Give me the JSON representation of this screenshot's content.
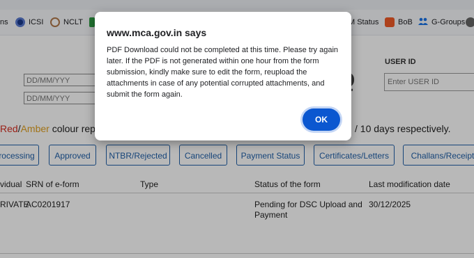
{
  "bookmarks": [
    {
      "label": "ns",
      "icon": "none",
      "color": "#202124"
    },
    {
      "label": "ICSI",
      "icon": "icsi-logo-icon",
      "color": "#1a3a8c"
    },
    {
      "label": "NCLT",
      "icon": "nclt-emblem-icon",
      "color": "#8c5a2a"
    },
    {
      "label": "M Status",
      "icon": "none",
      "color": "#202124"
    },
    {
      "label": "BoB",
      "icon": "bob-logo-icon",
      "color": "#f05a28"
    },
    {
      "label": "G-Groups",
      "icon": "groups-icon",
      "color": "#1a73e8"
    }
  ],
  "form": {
    "from_date_placeholder": "DD/MM/YYY",
    "to_date_placeholder": "DD/MM/YYY",
    "user_id_label": "USER ID",
    "user_id_placeholder": "Enter USER ID"
  },
  "notice": {
    "red": "Red",
    "slash": "/",
    "amber": "Amber",
    "text": " colour repr",
    "tail": "/ 10 days respectively."
  },
  "tabs": [
    {
      "label": "rocessing"
    },
    {
      "label": "Approved"
    },
    {
      "label": "NTBR/Rejected"
    },
    {
      "label": "Cancelled"
    },
    {
      "label": "Payment Status"
    },
    {
      "label": "Certificates/Letters"
    },
    {
      "label": "Challans/Receipts"
    }
  ],
  "table": {
    "headers": [
      "vidual",
      "SRN of e-form",
      "Type",
      "Status of the form",
      "Last modification date"
    ],
    "rows": [
      {
        "col1": "RIVATE",
        "srn": "AC0201917",
        "type": "",
        "status_line1": "Pending for DSC Upload and",
        "status_line2": "Payment",
        "date": "30/12/2025"
      }
    ]
  },
  "dialog": {
    "title": "www.mca.gov.in says",
    "message": "PDF Download could not be completed at this time. Please try again later. If the PDF is not generated within one hour from the form submission, kindly make sure to edit the form, reupload the attachments in case of any potential corrupted attachments, and submit the form again.",
    "ok_label": "OK"
  },
  "colors": {
    "accent": "#0b57d0",
    "tab_border": "#1f5fa8",
    "red": "#d62d20",
    "amber": "#e0a020"
  }
}
